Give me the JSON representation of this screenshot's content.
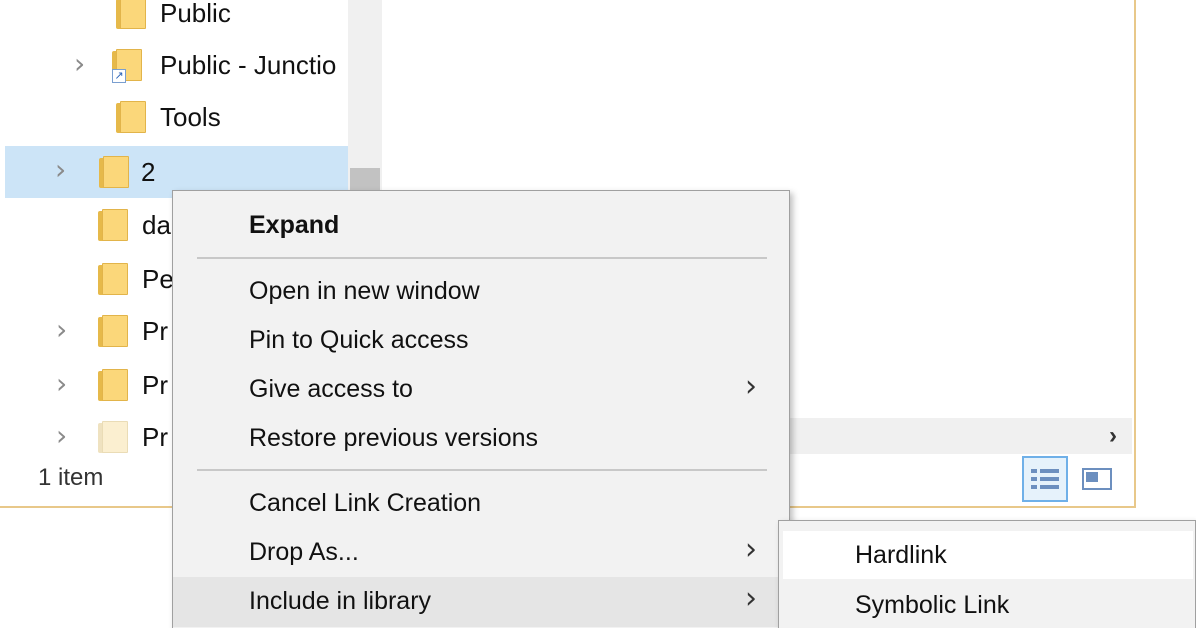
{
  "nav_tree": {
    "items": [
      {
        "label": "Public",
        "has_chevron": false
      },
      {
        "label": "Public - Junctio",
        "has_chevron": true,
        "shortcut": true
      },
      {
        "label": "Tools",
        "has_chevron": false
      },
      {
        "label": "2",
        "has_chevron": true,
        "selected": true
      },
      {
        "label": "da",
        "has_chevron": false
      },
      {
        "label": "Pe",
        "has_chevron": false
      },
      {
        "label": "Pr",
        "has_chevron": true
      },
      {
        "label": "Pr",
        "has_chevron": true
      },
      {
        "label": "Pr",
        "has_chevron": true,
        "pale": true
      }
    ]
  },
  "status_bar": {
    "item_count": "1 item"
  },
  "icons": {
    "chevron": "chevron-right-icon",
    "folder": "folder-icon",
    "submenu_arrow": "submenu-arrow-icon",
    "scroll_right": "scroll-right-icon"
  },
  "context_menu": {
    "expand": "Expand",
    "open_new_window": "Open in new window",
    "pin_quick_access": "Pin to Quick access",
    "give_access": "Give access to",
    "restore_versions": "Restore previous versions",
    "cancel_link": "Cancel Link Creation",
    "drop_as": "Drop As...",
    "include_library": "Include in library"
  },
  "submenu": {
    "hardlink": "Hardlink",
    "symbolic_link": "Symbolic Link"
  },
  "colors": {
    "selection": "#cce4f7",
    "folder": "#fbd77a",
    "menu_bg": "#f2f2f2",
    "window_border": "#e8c88a"
  }
}
